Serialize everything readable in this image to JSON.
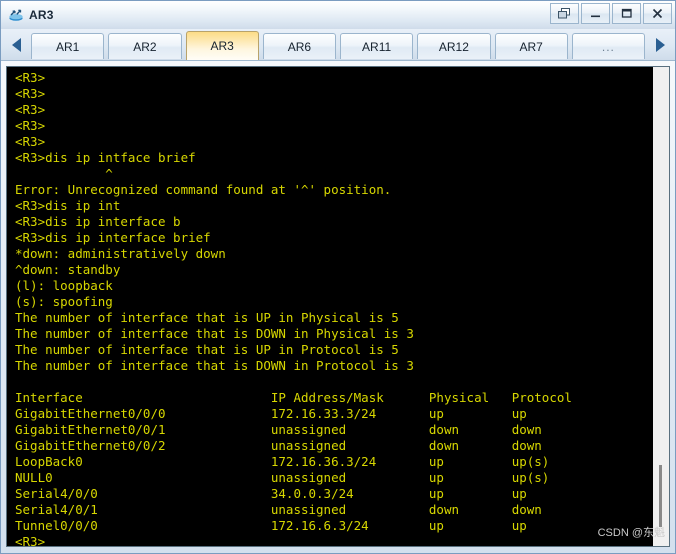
{
  "window": {
    "title": "AR3",
    "app_icon": "router-icon",
    "controls": [
      {
        "name": "restore-button",
        "glyph": "❐"
      },
      {
        "name": "minimize-button",
        "glyph": "—"
      },
      {
        "name": "maximize-button",
        "glyph": "❑"
      },
      {
        "name": "close-button",
        "glyph": "✕"
      }
    ]
  },
  "tabs": {
    "scroll_left": "◀",
    "scroll_right": "▶",
    "items": [
      {
        "label": "AR1",
        "active": false
      },
      {
        "label": "AR2",
        "active": false
      },
      {
        "label": "AR3",
        "active": true
      },
      {
        "label": "AR6",
        "active": false
      },
      {
        "label": "AR11",
        "active": false
      },
      {
        "label": "AR12",
        "active": false
      },
      {
        "label": "AR7",
        "active": false
      },
      {
        "label": "...",
        "active": false
      }
    ]
  },
  "terminal": {
    "foreground_color": "#d7d700",
    "background_color": "#000000",
    "lines": [
      "<R3>",
      "<R3>",
      "<R3>",
      "<R3>",
      "<R3>",
      "<R3>dis ip intface brief",
      "            ^",
      "Error: Unrecognized command found at '^' position.",
      "<R3>dis ip int",
      "<R3>dis ip interface b",
      "<R3>dis ip interface brief",
      "*down: administratively down",
      "^down: standby",
      "(l): loopback",
      "(s): spoofing",
      "The number of interface that is UP in Physical is 5",
      "The number of interface that is DOWN in Physical is 3",
      "The number of interface that is UP in Protocol is 5",
      "The number of interface that is DOWN in Protocol is 3",
      "",
      "Interface                         IP Address/Mask      Physical   Protocol",
      "GigabitEthernet0/0/0              172.16.33.3/24       up         up",
      "GigabitEthernet0/0/1              unassigned           down       down",
      "GigabitEthernet0/0/2              unassigned           down       down",
      "LoopBack0                         172.16.36.3/24       up         up(s)",
      "NULL0                             unassigned           up         up(s)",
      "Serial4/0/0                       34.0.0.3/24          up         up",
      "Serial4/0/1                       unassigned           down       down",
      "Tunnel0/0/0                       172.16.6.3/24        up         up",
      "<R3>"
    ]
  },
  "watermark": {
    "text": "CSDN @东魁"
  }
}
